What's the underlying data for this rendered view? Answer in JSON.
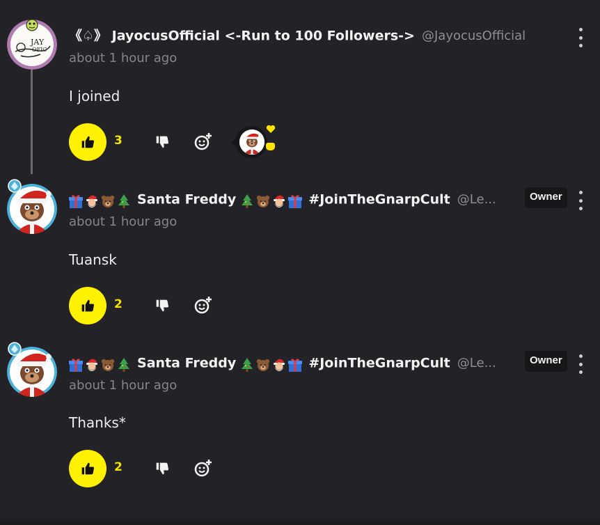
{
  "comments": [
    {
      "name": "《♤》 JayocusOfficial <-Run to 100 Followers->",
      "handle": "@JayocusOfficial",
      "timestamp": "about 1 hour ago",
      "body": "I joined",
      "likes": "3",
      "owner": "",
      "avatar_icon": "jayocus-avatar-icon",
      "reacted_by": "santa-freddy-avatar-icon"
    },
    {
      "name": "Santa Freddy",
      "name_suffix": "#JoinTheGnarpCult",
      "handle": "@Le...",
      "timestamp": "about 1 hour ago",
      "body": "Tuansk",
      "likes": "2",
      "owner": "Owner",
      "avatar_icon": "santa-freddy-avatar-icon"
    },
    {
      "name": "Santa Freddy",
      "name_suffix": "#JoinTheGnarpCult",
      "handle": "@Le...",
      "timestamp": "about 1 hour ago",
      "body": "Thanks*",
      "likes": "2",
      "owner": "Owner",
      "avatar_icon": "santa-freddy-avatar-icon"
    }
  ],
  "icons": {
    "like": "thumbs-up-icon",
    "dislike": "thumbs-down-icon",
    "react": "add-reaction-icon",
    "menu": "more-vertical-icon",
    "name_emojis": [
      "gift-icon",
      "santa-icon",
      "bear-icon",
      "christmas-tree-icon"
    ]
  },
  "colors": {
    "background": "#232327",
    "like_accent": "#fff200",
    "like_count": "#f1e200",
    "muted_text": "#85858a",
    "owner_badge_bg": "#17171a"
  }
}
